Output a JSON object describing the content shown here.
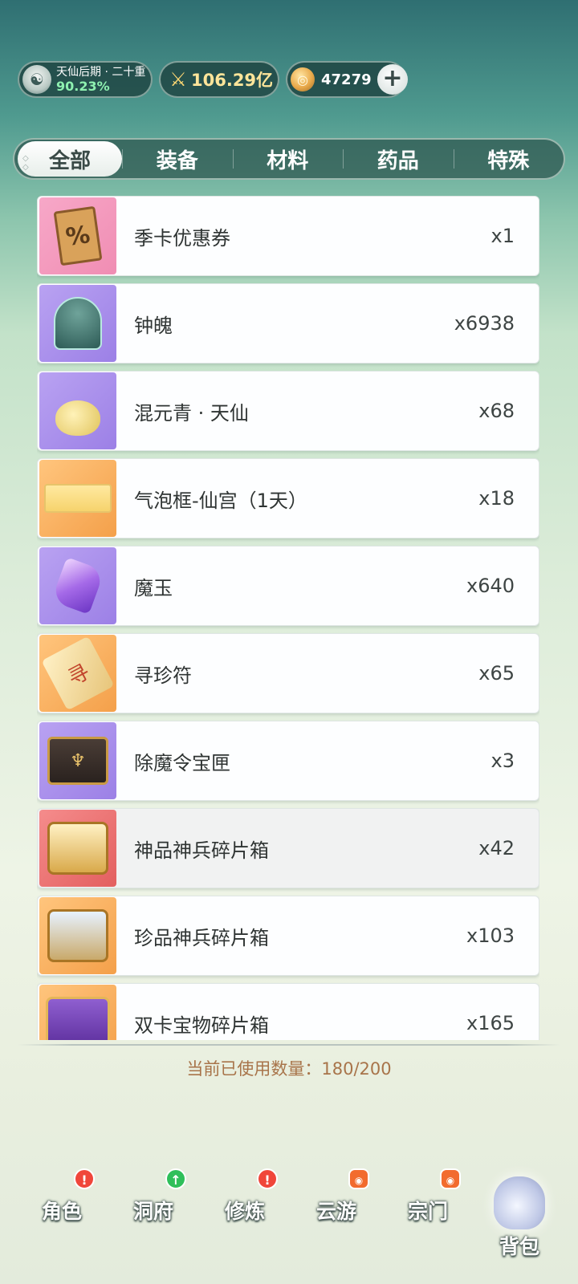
{
  "header": {
    "realm_name": "天仙后期 · 二十重",
    "realm_progress": "90.23%",
    "combat_power": "106.29亿",
    "currency_amount": "47279",
    "add_currency_symbol": "+"
  },
  "tabs": [
    {
      "label": "全部",
      "active": true
    },
    {
      "label": "装备",
      "active": false
    },
    {
      "label": "材料",
      "active": false
    },
    {
      "label": "药品",
      "active": false
    },
    {
      "label": "特殊",
      "active": false
    }
  ],
  "items": [
    {
      "name": "季卡优惠券",
      "qty": "x1",
      "icon": "coupon-icon",
      "bg": "pink",
      "glyph": "%"
    },
    {
      "name": "钟魄",
      "qty": "x6938",
      "icon": "bell-icon",
      "bg": "purple"
    },
    {
      "name": "混元青 · 天仙",
      "qty": "x68",
      "icon": "herb-icon",
      "bg": "purple"
    },
    {
      "name": "气泡框-仙宫（1天）",
      "qty": "x18",
      "icon": "bubble-frame-icon",
      "bg": "orange"
    },
    {
      "name": "魔玉",
      "qty": "x640",
      "icon": "gem-icon",
      "bg": "purple"
    },
    {
      "name": "寻珍符",
      "qty": "x65",
      "icon": "talisman-icon",
      "bg": "orange",
      "glyph": "寻"
    },
    {
      "name": "除魔令宝匣",
      "qty": "x3",
      "icon": "chest-icon",
      "bg": "purple",
      "glyph": "♆"
    },
    {
      "name": "神品神兵碎片箱",
      "qty": "x42",
      "icon": "gold-chest-icon",
      "bg": "red"
    },
    {
      "name": "珍品神兵碎片箱",
      "qty": "x103",
      "icon": "silver-chest-icon",
      "bg": "orange"
    },
    {
      "name": "双卡宝物碎片箱",
      "qty": "x165",
      "icon": "purple-chest-icon",
      "bg": "orange"
    }
  ],
  "selected_item_index": 7,
  "capacity_text": "当前已使用数量：180/200",
  "bottom_nav": [
    {
      "label": "角色",
      "badge": "!",
      "badge_type": "alert"
    },
    {
      "label": "洞府",
      "badge": "↑",
      "badge_type": "up"
    },
    {
      "label": "修炼",
      "badge": "!",
      "badge_type": "alert"
    },
    {
      "label": "云游",
      "badge": "◉",
      "badge_type": "chest"
    },
    {
      "label": "宗门",
      "badge": "◉",
      "badge_type": "chest"
    },
    {
      "label": "背包",
      "badge": "",
      "badge_type": "active"
    }
  ],
  "colors": {
    "accent_green": "#8ef0b0",
    "capacity_text": "#a8744a",
    "badge_red": "#f0463a",
    "badge_green": "#2fbf5a"
  }
}
